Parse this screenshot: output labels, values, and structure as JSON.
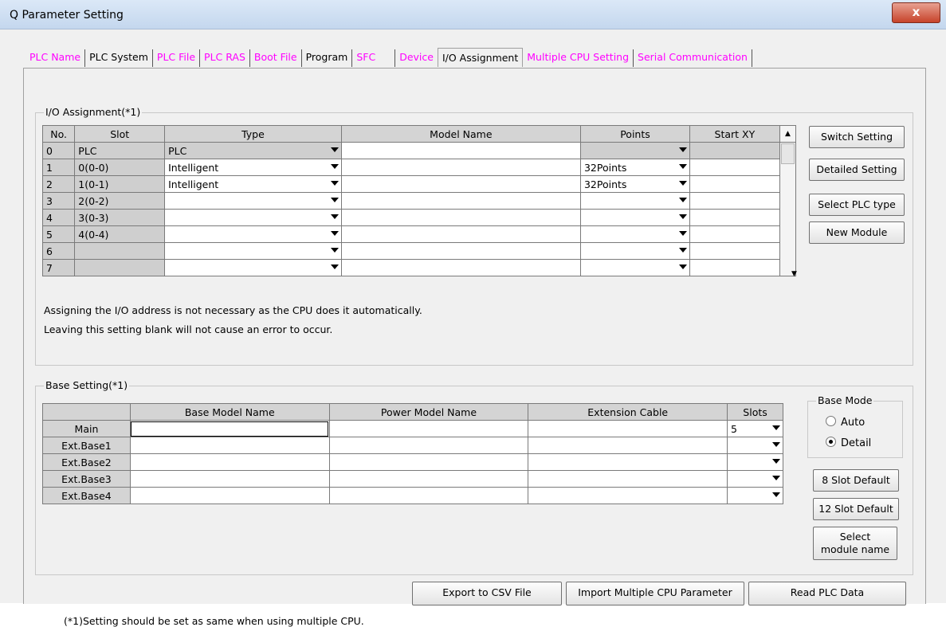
{
  "window": {
    "title": "Q Parameter Setting",
    "close_glyph": "x"
  },
  "tabs": [
    {
      "label": "PLC Name"
    },
    {
      "label": "PLC System"
    },
    {
      "label": "PLC File"
    },
    {
      "label": "PLC RAS"
    },
    {
      "label": "Boot File"
    },
    {
      "label": "Program"
    },
    {
      "label": "SFC"
    },
    {
      "label": "Device"
    },
    {
      "label": "I/O Assignment"
    },
    {
      "label": "Multiple CPU Setting"
    },
    {
      "label": "Serial Communication"
    }
  ],
  "io_assignment": {
    "legend": "I/O Assignment(*1)",
    "headers": [
      "No.",
      "Slot",
      "Type",
      "Model Name",
      "Points",
      "Start XY"
    ],
    "rows": [
      {
        "no": "0",
        "slot": "PLC",
        "type": "PLC",
        "model": "",
        "points": "",
        "start": ""
      },
      {
        "no": "1",
        "slot": "0(0-0)",
        "type": "Intelligent",
        "model": "",
        "points": "32Points",
        "start": ""
      },
      {
        "no": "2",
        "slot": "1(0-1)",
        "type": "Intelligent",
        "model": "",
        "points": "32Points",
        "start": ""
      },
      {
        "no": "3",
        "slot": "2(0-2)",
        "type": "",
        "model": "",
        "points": "",
        "start": ""
      },
      {
        "no": "4",
        "slot": "3(0-3)",
        "type": "",
        "model": "",
        "points": "",
        "start": ""
      },
      {
        "no": "5",
        "slot": "4(0-4)",
        "type": "",
        "model": "",
        "points": "",
        "start": ""
      },
      {
        "no": "6",
        "slot": "",
        "type": "",
        "model": "",
        "points": "",
        "start": ""
      },
      {
        "no": "7",
        "slot": "",
        "type": "",
        "model": "",
        "points": "",
        "start": ""
      }
    ],
    "buttons": {
      "switch": "Switch Setting",
      "detailed": "Detailed Setting",
      "select_plc": "Select PLC type",
      "new_module": "New Module"
    },
    "note1": "Assigning the I/O address is not necessary as the CPU does it automatically.",
    "note2": "Leaving this setting blank will not cause an error to occur."
  },
  "base_setting": {
    "legend": "Base Setting(*1)",
    "headers": [
      "",
      "Base Model Name",
      "Power Model Name",
      "Extension Cable",
      "Slots"
    ],
    "rows": [
      {
        "label": "Main",
        "slots": "5"
      },
      {
        "label": "Ext.Base1",
        "slots": ""
      },
      {
        "label": "Ext.Base2",
        "slots": ""
      },
      {
        "label": "Ext.Base3",
        "slots": ""
      },
      {
        "label": "Ext.Base4",
        "slots": ""
      }
    ],
    "base_mode": {
      "legend": "Base Mode",
      "auto": "Auto",
      "detail": "Detail",
      "selected": "Detail"
    },
    "buttons": {
      "slot8": "8 Slot Default",
      "slot12": "12 Slot Default",
      "select_module_line1": "Select",
      "select_module_line2": "module name"
    }
  },
  "bottom": {
    "export_csv": "Export to CSV File",
    "import_cpu": "Import Multiple CPU Parameter",
    "read_plc": "Read PLC Data",
    "footnote": "(*1)Setting should be set as same when using multiple CPU."
  }
}
